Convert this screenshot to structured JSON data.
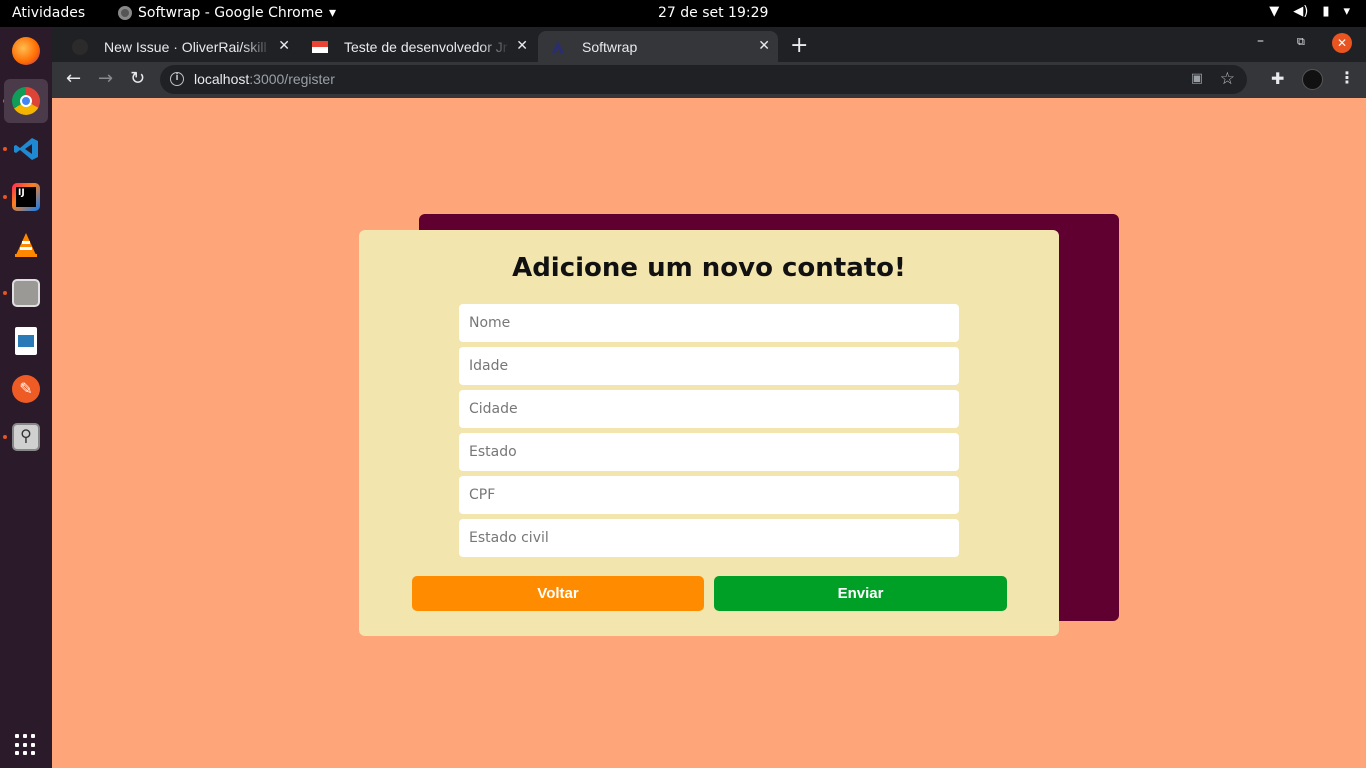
{
  "system": {
    "activities": "Atividades",
    "app_menu": "Softwrap - Google Chrome",
    "clock": "27 de set  19:29"
  },
  "dock": {
    "items": [
      "firefox-icon",
      "chrome-icon",
      "vscode-icon",
      "intellij-icon",
      "vlc-icon",
      "files-icon",
      "writer-icon",
      "postman-icon",
      "search-icon"
    ],
    "accent": "#e95420"
  },
  "browser": {
    "tabs": [
      {
        "label": "New Issue · OliverRai/skill",
        "active": false
      },
      {
        "label": "Teste de desenvolvedor Jr",
        "active": false
      },
      {
        "label": "Softwrap",
        "active": true
      }
    ],
    "url_host": "localhost",
    "url_path": ":3000/register"
  },
  "page": {
    "title": "Adicione um novo contato!",
    "fields": [
      {
        "placeholder": "Nome",
        "value": ""
      },
      {
        "placeholder": "Idade",
        "value": ""
      },
      {
        "placeholder": "Cidade",
        "value": ""
      },
      {
        "placeholder": "Estado",
        "value": ""
      },
      {
        "placeholder": "CPF",
        "value": ""
      },
      {
        "placeholder": "Estado civil",
        "value": ""
      }
    ],
    "back_label": "Voltar",
    "send_label": "Enviar",
    "colors": {
      "background": "#ffa57a",
      "card": "#f2e5ae",
      "shadow_card": "#5f0030",
      "back_button": "#ff8c00",
      "send_button": "#00a026"
    }
  }
}
